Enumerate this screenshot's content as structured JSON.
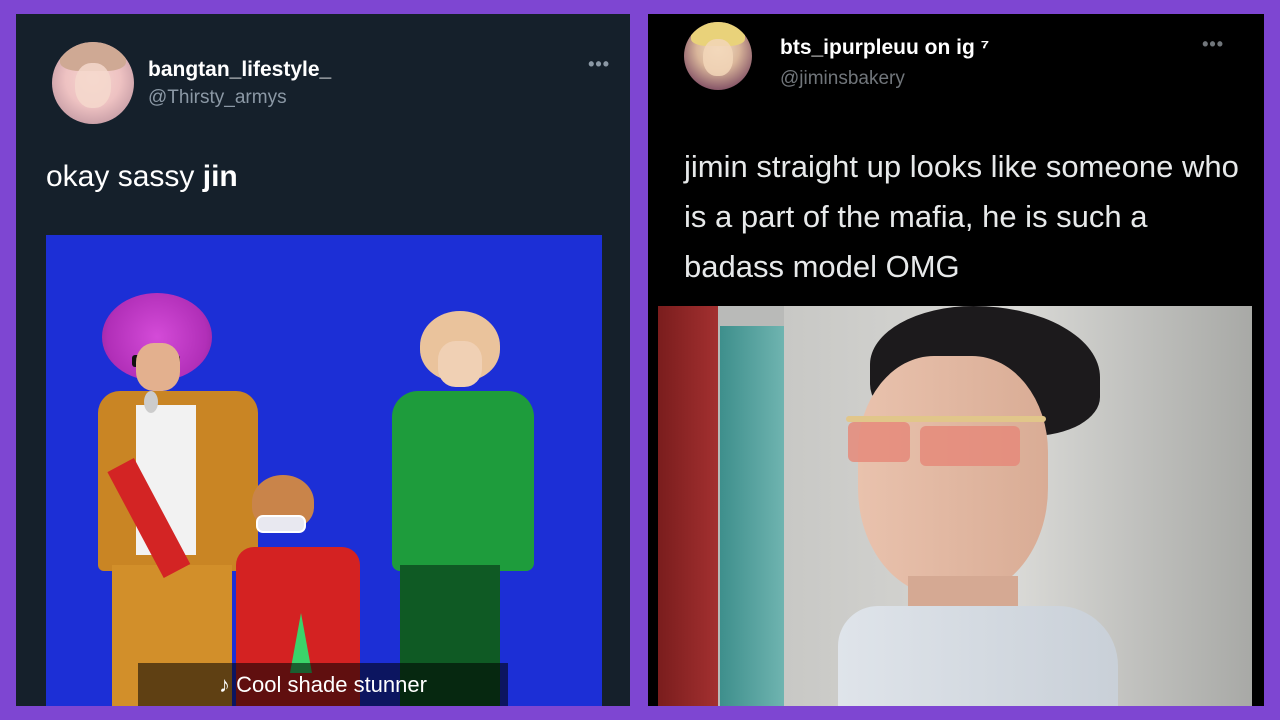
{
  "left_tweet": {
    "display_name": "bangtan_lifestyle_",
    "handle": "@Thirsty_armys",
    "more_icon": "more-horizontal-icon",
    "more_glyph": "•••",
    "text_plain": "okay sassy ",
    "text_bold": "jin",
    "media": {
      "caption": "♪ Cool shade stunner",
      "background_color": "#1c2fd6"
    }
  },
  "right_tweet": {
    "display_name": "bts_ipurpleuu on ig ⁷",
    "handle": "@jiminsbakery",
    "more_icon": "more-horizontal-icon",
    "more_glyph": "•••",
    "text": "jimin straight up looks like someone who is a part of the mafia, he is such a badass model OMG"
  },
  "colors": {
    "frame": "#7e46d2",
    "left_card_bg": "#15202b",
    "right_card_bg": "#000000"
  }
}
